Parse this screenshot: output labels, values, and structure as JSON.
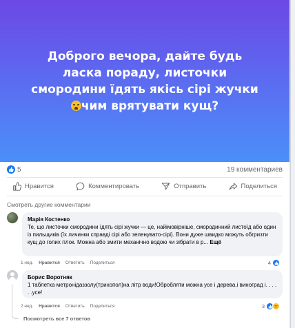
{
  "post": {
    "text_before_emoji": "Доброго вечора, дайте будь ласка пораду, листочки смородини їдять якісь сірі жучки",
    "text_after_emoji": "чим врятувати кущ?",
    "emoji": "sad-face"
  },
  "stats": {
    "likes": "5",
    "comments": "19 комментариев"
  },
  "actions": {
    "like": "Нравится",
    "comment": "Комментировать",
    "send": "Отправить",
    "share": "Поделиться"
  },
  "see_more_comments": "Смотреть другие комментарии",
  "comments": [
    {
      "author": "Марія Костенко",
      "text": "Те, що листочки смородини їдять сірі жучки — це, найімовірніше, смородинний листоїд або один із пильщиків (їх личинки справді сірі або зеленувато-сірі). Вони дуже швидко можуть обгризти кущ до голих гілок. Можна або змити механічно водою чи зібрати в р...",
      "more": "Ещё",
      "time": "1 нед.",
      "like": "Нравится",
      "reply": "Ответить",
      "share": "Поделиться",
      "reactions": "4"
    },
    {
      "author": "Борис Воротняк",
      "text": "1 таблетка метронідаззолу(трихопол)на літр води!Обробляти можна усе і дерева,і виноград і. . . . . .усе!",
      "time": "2 нед.",
      "like": "Нравится",
      "reply": "Ответить",
      "share": "Поделиться",
      "reactions": "3"
    }
  ],
  "view_all_replies": "Посмотреть все 7 ответов",
  "colors": {
    "gradient_top": "#6c48e4",
    "gradient_bottom": "#4b8ff8",
    "facebook_blue": "#1877f2",
    "muted_text": "#65676b",
    "bubble_bg": "#f0f2f5"
  }
}
